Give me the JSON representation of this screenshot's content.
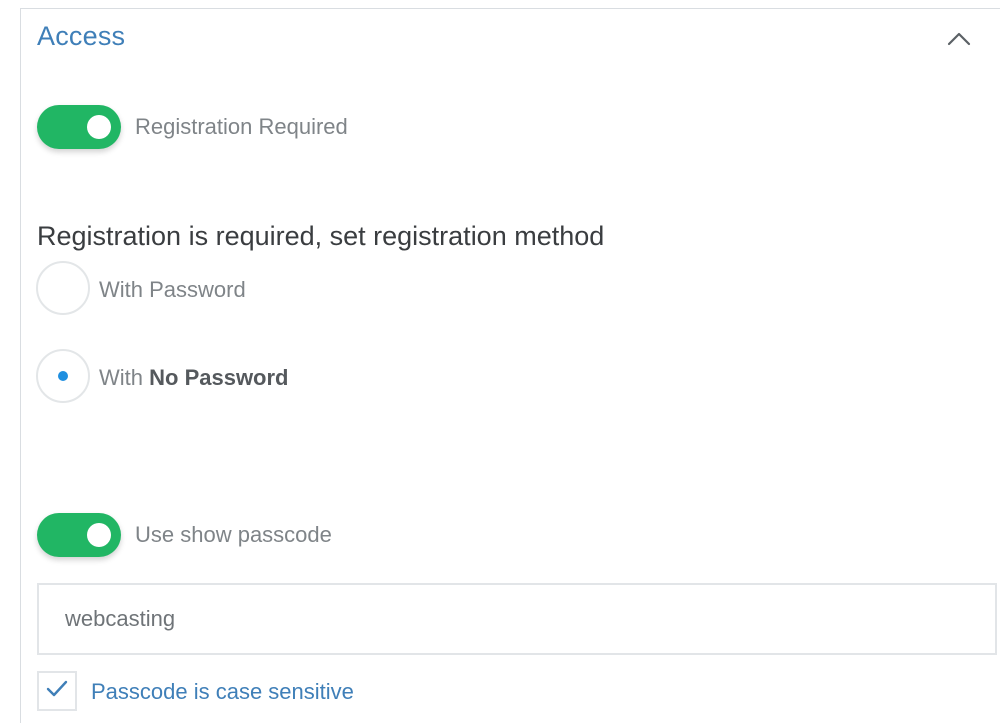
{
  "section": {
    "title": "Access",
    "collapse_icon": "chevron-up-icon"
  },
  "registration_toggle": {
    "label": "Registration Required",
    "on": true,
    "color": "#21b664"
  },
  "registration_method": {
    "heading": "Registration is required, set registration method",
    "options": [
      {
        "prefix": "With Password",
        "emphasis": "",
        "selected": false
      },
      {
        "prefix": "With ",
        "emphasis": "No Password",
        "selected": true
      }
    ],
    "selected_color": "#1f8fe0"
  },
  "passcode_toggle": {
    "label": "Use show passcode",
    "on": true
  },
  "passcode": {
    "value": "webcasting"
  },
  "case_sensitive": {
    "label": "Passcode is case sensitive",
    "checked": true,
    "check_icon": "checkmark-icon"
  }
}
